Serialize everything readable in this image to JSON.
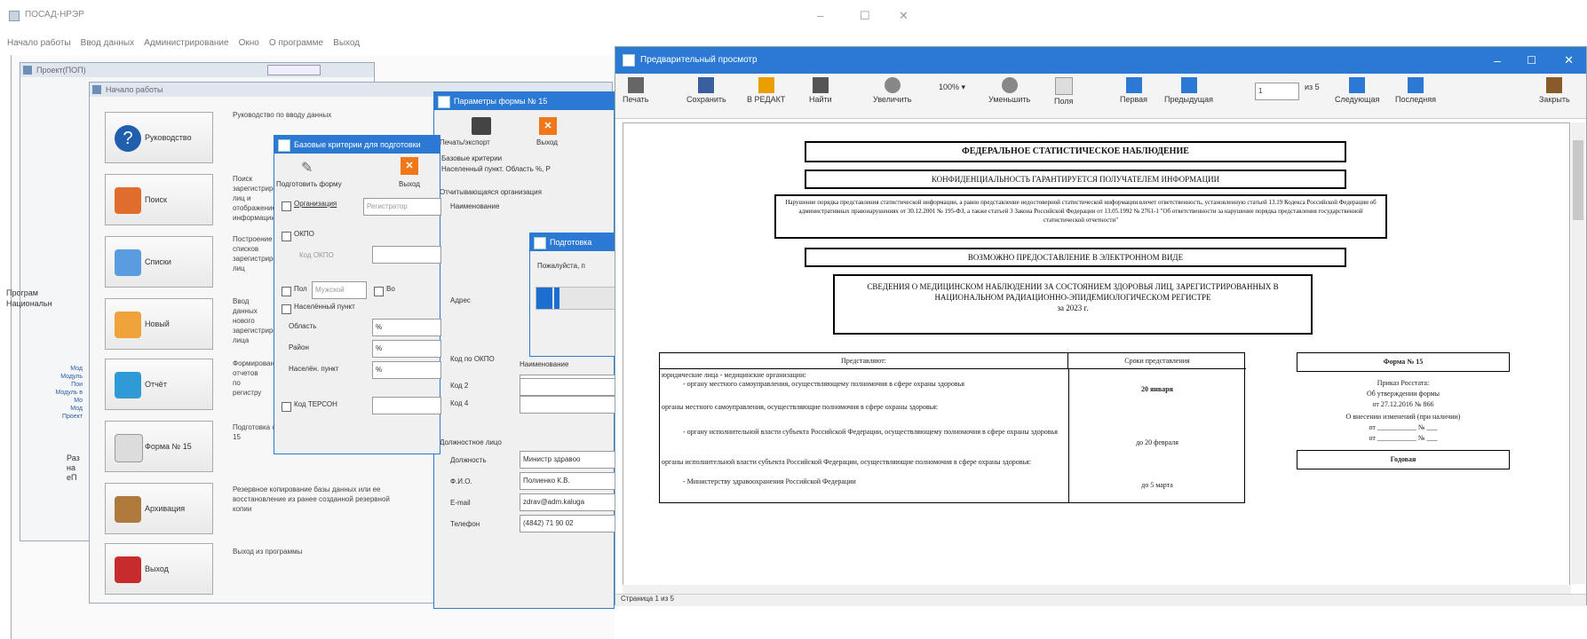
{
  "main_window": {
    "title": "ПОСАД-НРЭР",
    "menu": [
      "Начало работы",
      "Ввод данных",
      "Администрирование",
      "Окно",
      "О программе",
      "Выход"
    ],
    "controls": {
      "minimize": "–",
      "maximize": "☐",
      "close": "✕"
    }
  },
  "prev_pane": {
    "title": "Проект(ПОП)",
    "side_texts": [
      "Програм",
      "Национальн"
    ],
    "side_links": [
      "Мод",
      "Модуль",
      "Пои",
      "Модуль в",
      "Мо",
      "Мод",
      "Проект"
    ],
    "side_lower": [
      "Раз",
      "на",
      "еП"
    ]
  },
  "start_window": {
    "title": "Начало работы"
  },
  "nav_buttons": [
    {
      "label": "Руководство",
      "icon": "help-icon",
      "desc": "Руководство по вводу данных"
    },
    {
      "label": "Поиск",
      "icon": "search-icon",
      "desc": "Поиск зарегистрированных лиц и отображение информации"
    },
    {
      "label": "Списки",
      "icon": "lists-icon",
      "desc": "Построение списков зарегистрированных лиц"
    },
    {
      "label": "Новый",
      "icon": "new-person-icon",
      "desc": "Ввод данных нового зарегистрированного лица"
    },
    {
      "label": "Отчёт",
      "icon": "report-icon",
      "desc": "Формирование отчетов по регистру"
    },
    {
      "label": "Форма № 15",
      "icon": "form-icon",
      "desc": "Подготовка статистической отчетности по форме № 15"
    },
    {
      "label": "Архивация",
      "icon": "archive-icon",
      "desc": "Резервное копирование базы данных или ее восстановление из ранее созданной резервной копии"
    },
    {
      "label": "Выход",
      "icon": "exit-icon",
      "desc": "Выход из программы"
    }
  ],
  "criteria_dialog": {
    "title": "Базовые критерии для подготовки",
    "prepare_label": "Подготовить форму",
    "exit_label": "Выход",
    "org_label": "Организация",
    "org_value": "Регистратор",
    "okpo_label": "ОКПО",
    "okpo_code_label": "Код ОКПО",
    "sex_label": "Пол",
    "sex_value": "Мужской",
    "vo_label": "Во",
    "settlement_label": "Населённый пункт",
    "region_label": "Область",
    "region_value": "%",
    "district_label": "Район",
    "district_value": "%",
    "locality_label": "Населён. пункт",
    "locality_value": "%",
    "terson_label": "Код ТЕРСОН"
  },
  "form_params_dialog": {
    "title": "Параметры формы № 15",
    "print_label": "Печать/экспорт",
    "exit_label": "Выход",
    "base_criteria_label": "Базовые критерии",
    "base_criteria_value": "Населенный пункт. Область %, Р",
    "org_section": "Отчитывающаяся организация",
    "name_label": "Наименование",
    "address_label": "Адрес",
    "okpo_label": "Код по ОКПО",
    "code2_label": "Код 2",
    "code4_label": "Код 4",
    "org_caption": "Наименование",
    "official_section": "Должностное лицо",
    "position_label": "Должность",
    "position_value": "Министр здравоо",
    "fio_label": "Ф.И.О.",
    "fio_value": "Полиенко К.В.",
    "email_label": "E-mail",
    "email_value": "zdrav@adm.kaluga",
    "phone_label": "Телефон",
    "phone_value": "(4842) 71 90 02"
  },
  "progress_dialog": {
    "title": "Подготовка",
    "message": "Пожалуйста, п",
    "progress_fraction": 0.3
  },
  "preview_window": {
    "title": "Предварительный просмотр",
    "toolbar": {
      "print": "Печать",
      "save": "Сохранить",
      "editor": "В РЕДАКТ",
      "find": "Найти",
      "zoom_in": "Увеличить",
      "zoom_value": "100%",
      "zoom_out": "Уменьшить",
      "fields": "Поля",
      "first": "Первая",
      "prev": "Предыдущая",
      "page_value": "1",
      "page_of": "из 5",
      "next": "Следующая",
      "last": "Последняя",
      "close": "Закрыть"
    },
    "status": "Страница 1 из 5",
    "document": {
      "header1": "ФЕДЕРАЛЬНОЕ СТАТИСТИЧЕСКОЕ НАБЛЮДЕНИЕ",
      "header2": "КОНФИДЕНЦИАЛЬНОСТЬ ГАРАНТИРУЕТСЯ ПОЛУЧАТЕЛЕМ ИНФОРМАЦИИ",
      "warning": "Нарушение порядка представления статистической информации, а равно представление недостоверной статистической информации влечет ответственность, установленную статьей 13.19 Кодекса Российской Федерации об административных правонарушениях от 30.12.2001 № 195-ФЗ, а также статьей 3 Закона Российской Федерации от 13.05.1992 № 2761-1 \"Об ответственности за нарушение порядка представления государственной статистической отчетности\"",
      "electronic": "ВОЗМОЖНО ПРЕДОСТАВЛЕНИЕ В ЭЛЕКТРОННОМ ВИДЕ",
      "report_title": "СВЕДЕНИЯ О МЕДИЦИНСКОМ НАБЛЮДЕНИИ ЗА СОСТОЯНИЕМ ЗДОРОВЬЯ ЛИЦ, ЗАРЕГИСТРИРОВАННЫХ В НАЦИОНАЛЬНОМ РАДИАЦИОННО-ЭПИДЕМИОЛОГИЧЕСКОМ РЕГИСТРЕ",
      "report_year": "за 2023 г.",
      "col_submitters": "Представляют:",
      "col_deadlines": "Сроки представления",
      "rows": [
        {
          "text": "юридические лица - медицинские организации:",
          "deadline": ""
        },
        {
          "text": "- органу местного самоуправления, осуществляющему полномочия в сфере охраны здоровья",
          "deadline": "20 января"
        },
        {
          "text": "органы местного самоуправления, осуществляющие полномочия в сфере охраны здоровья:",
          "deadline": ""
        },
        {
          "text": "- органу исполнительной власти субъекта Российской Федерации, осуществляющему полномочия в сфере охраны здоровья",
          "deadline": "до 20 февраля"
        },
        {
          "text": "органы исполнительной власти субъекта Российской Федерации, осуществляющие полномочия в сфере охраны здоровья:",
          "deadline": ""
        },
        {
          "text": "- Министерству здравоохранения Российской Федерации",
          "deadline": "до 5 марта"
        }
      ],
      "form_box": {
        "title": "Форма № 15",
        "order": "Приказ Росстата:",
        "approval": "Об утверждении формы",
        "order_date": "от 27.12.2016 № 866",
        "changes": "О внесении изменений (при наличии)",
        "from1": "от ___________ № ___",
        "from2": "от ___________ № ___",
        "annual": "Годовая"
      }
    }
  }
}
